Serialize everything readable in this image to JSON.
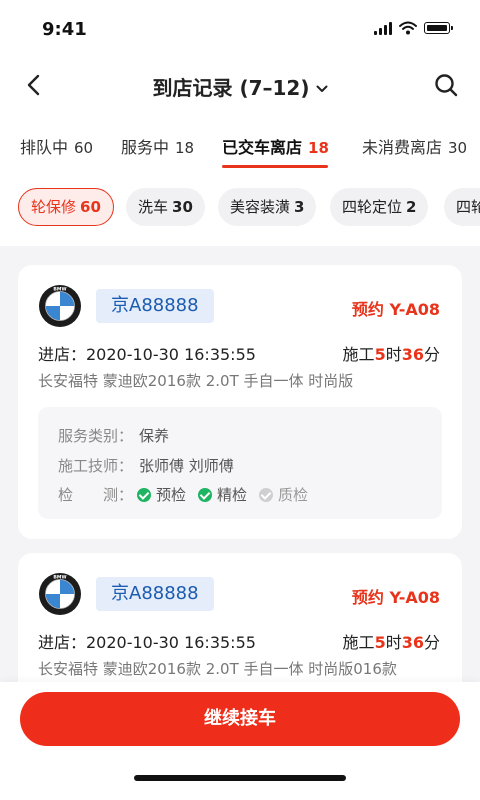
{
  "status": {
    "time": "9:41"
  },
  "nav": {
    "title": "到店记录 (7–12)"
  },
  "tabs": [
    {
      "label": "排队中",
      "count": "60"
    },
    {
      "label": "服务中",
      "count": "18"
    },
    {
      "label": "已交车离店",
      "count": "18"
    },
    {
      "label": "未消费离店",
      "count": "30"
    }
  ],
  "chips": [
    {
      "label": "轮保修",
      "count": "60"
    },
    {
      "label": "洗车",
      "count": "30"
    },
    {
      "label": "美容装潢",
      "count": "3"
    },
    {
      "label": "四轮定位",
      "count": "2"
    },
    {
      "label": "四轮",
      "count": ""
    }
  ],
  "cards": [
    {
      "logo_text": "BMW",
      "plate": "京A88888",
      "appointment": "预约 Y-A08",
      "entry": "进店：2020-10-30 16:35:55",
      "duration": {
        "prefix": "施工",
        "hours": "5",
        "hours_unit": "时",
        "minutes": "36",
        "minutes_unit": "分"
      },
      "model": "长安福特 蒙迪欧2016款 2.0T 手自一体 时尚版",
      "service_label": "服务类别：",
      "service_value": "保养",
      "tech_label": "施工技师：",
      "tech_value": "张师傅 刘师傅",
      "check_label": "检　　测：",
      "checks": [
        {
          "label": "预检",
          "status": "done"
        },
        {
          "label": "精检",
          "status": "done"
        },
        {
          "label": "质检",
          "status": "pending"
        }
      ]
    },
    {
      "logo_text": "BMW",
      "plate": "京A88888",
      "appointment": "预约 Y-A08",
      "entry": "进店：2020-10-30 16:35:55",
      "duration": {
        "prefix": "施工",
        "hours": "5",
        "hours_unit": "时",
        "minutes": "36",
        "minutes_unit": "分"
      },
      "model": "长安福特 蒙迪欧2016款 2.0T 手自一体 时尚版016款"
    }
  ],
  "cta": {
    "label": "继续接车"
  },
  "colors": {
    "accent": "#e8341b",
    "plate_bg": "#e4edf9",
    "plate_text": "#1b5bb0",
    "success": "#1fb462"
  }
}
